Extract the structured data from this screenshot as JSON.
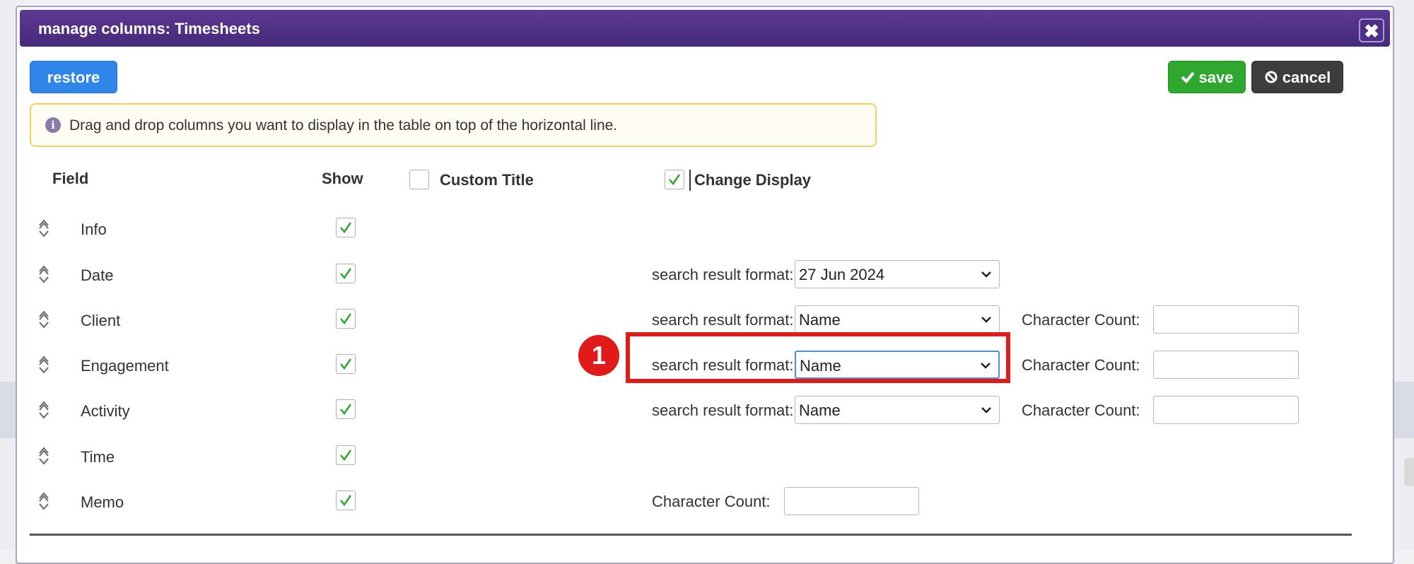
{
  "dialog": {
    "title": "manage columns: Timesheets",
    "close_label": "✖"
  },
  "toolbar": {
    "restore_label": "restore",
    "save_label": "save",
    "cancel_label": "cancel"
  },
  "info": {
    "text": "Drag and drop columns you want to display in the table on top of the horizontal line."
  },
  "headers": {
    "field": "Field",
    "show": "Show",
    "custom_title": "Custom Title",
    "change_display": "Change Display",
    "custom_title_checked": false,
    "change_display_checked": true
  },
  "rows": [
    {
      "field": "Info",
      "show": true
    },
    {
      "field": "Date",
      "show": true,
      "format_label": "search result format:",
      "format_value": "27 Jun 2024"
    },
    {
      "field": "Client",
      "show": true,
      "format_label": "search result format:",
      "format_value": "Name",
      "count_label": "Character Count:",
      "count_value": ""
    },
    {
      "field": "Engagement",
      "show": true,
      "format_label": "search result format:",
      "format_value": "Name",
      "count_label": "Character Count:",
      "count_value": ""
    },
    {
      "field": "Activity",
      "show": true,
      "format_label": "search result format:",
      "format_value": "Name",
      "count_label": "Character Count:",
      "count_value": ""
    },
    {
      "field": "Time",
      "show": true
    },
    {
      "field": "Memo",
      "show": true,
      "count_label": "Character Count:",
      "count_value": ""
    }
  ],
  "annotation": {
    "badge_number": "1",
    "color": "#e11a1a"
  },
  "colors": {
    "titlebar": "#4d2f86",
    "restore": "#2f86e8",
    "save": "#2ea82e",
    "cancel": "#3d3d3d",
    "check": "#2ea82e"
  }
}
